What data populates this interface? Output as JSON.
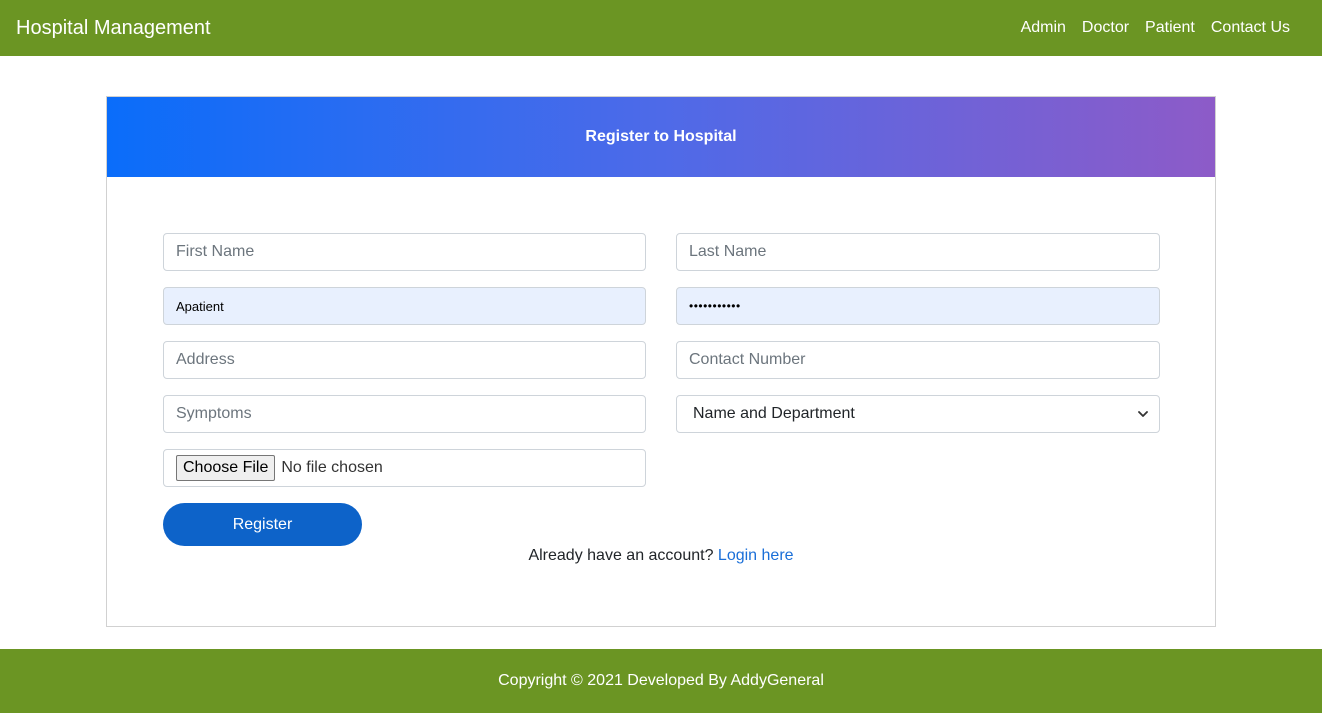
{
  "navbar": {
    "brand": "Hospital Management",
    "links": [
      "Admin",
      "Doctor",
      "Patient",
      "Contact Us"
    ]
  },
  "form": {
    "header": "Register to Hospital",
    "first_name_placeholder": "First Name",
    "last_name_placeholder": "Last Name",
    "username_value": "Apatient",
    "password_value": "•••••••••••",
    "address_placeholder": "Address",
    "contact_placeholder": "Contact Number",
    "symptoms_placeholder": "Symptoms",
    "department_selected": "Name and Department",
    "file_button": "Choose File",
    "file_status": "No file chosen",
    "register_label": "Register",
    "login_prompt": "Already have an account?",
    "login_link": "Login here"
  },
  "footer": {
    "text": "Copyright © 2021 Developed By AddyGeneral"
  },
  "colors": {
    "navbar_bg": "#6b9523",
    "header_gradient_start": "#0a6dfa",
    "header_gradient_end": "#8d5bc8",
    "register_button": "#0d63c9",
    "link": "#1a6fd8",
    "autofill_bg": "#e8f0fe"
  },
  "icons": {
    "select_arrow": "chevron-down-icon"
  }
}
